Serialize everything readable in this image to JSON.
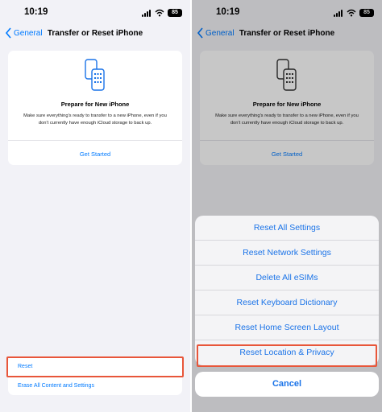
{
  "screens": [
    {
      "status": {
        "time": "10:19",
        "battery": "85"
      },
      "nav": {
        "back_label": "General",
        "title": "Transfer or Reset iPhone"
      },
      "card": {
        "heading": "Prepare for New iPhone",
        "description": "Make sure everything's ready to transfer to a new iPhone, even if you don't currently have enough iCloud storage to back up.",
        "link": "Get Started"
      },
      "reset_group": {
        "reset_label": "Reset",
        "erase_label": "Erase All Content and Settings"
      }
    },
    {
      "status": {
        "time": "10:19",
        "battery": "85"
      },
      "nav": {
        "back_label": "General",
        "title": "Transfer or Reset iPhone"
      },
      "card": {
        "heading": "Prepare for New iPhone",
        "description": "Make sure everything's ready to transfer to a new iPhone, even if you don't currently have enough iCloud storage to back up.",
        "link": "Get Started"
      },
      "action_sheet": {
        "options": [
          "Reset All Settings",
          "Reset Network Settings",
          "Delete All eSIMs",
          "Reset Keyboard Dictionary",
          "Reset Home Screen Layout",
          "Reset Location & Privacy"
        ],
        "cancel_label": "Cancel"
      }
    }
  ],
  "colors": {
    "accent": "#007aff",
    "highlight": "#e8563a"
  }
}
